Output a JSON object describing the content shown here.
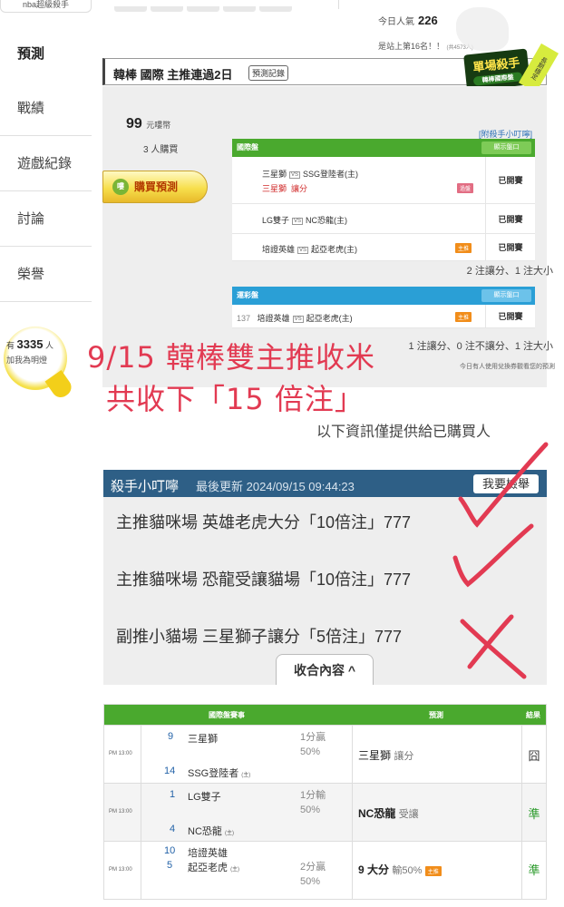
{
  "sidebar": {
    "top_label": "nba超級殺手",
    "items": [
      {
        "label": "預測"
      },
      {
        "label": "戰績"
      },
      {
        "label": "遊戲紀錄"
      },
      {
        "label": "討論"
      },
      {
        "label": "榮譽"
      }
    ],
    "fans": {
      "prefix": "有",
      "count": "3335",
      "suffix": "人",
      "sub": "加我為明燈"
    }
  },
  "header": {
    "popular_label": "今日人氣",
    "popular_value": "226",
    "rank_text": "是站上第16名！！",
    "rank_small": "(共4573人)"
  },
  "title_bar": {
    "title": "韓棒 國際 主推連過2日",
    "record_button": "預測記錄",
    "badge_main": "單場殺手",
    "badge_sub": "韓棒國際盤",
    "badge_ribbon": "長期穩定"
  },
  "purchase": {
    "price": "99",
    "price_unit": "元嘍幣",
    "buyers": "3 人購買",
    "buy_button": "購買預測",
    "tip_link": "[附殺手小叮嚀]"
  },
  "intl_table": {
    "header": "國際盤",
    "show_button": "顯示盤口",
    "rows": [
      {
        "line1": "三星獅",
        "line1b": "SSG登陸者(主)",
        "pick": "三星獅",
        "pick_type": "讓分",
        "tag": "過盤",
        "result": "已開賽"
      },
      {
        "line1": "LG雙子",
        "line1b": "NC恐龍(主)",
        "result": "已開賽"
      },
      {
        "line1": "培證英雄",
        "line1b": "起亞老虎(主)",
        "tag": "主推",
        "result": "已開賽"
      }
    ],
    "summary": "2 注讓分、1 注大小"
  },
  "sport_table": {
    "header": "運彩盤",
    "show_button": "顯示盤口",
    "rows": [
      {
        "num": "137",
        "line1": "培證英雄",
        "line1b": "起亞老虎(主)",
        "tag": "主推",
        "result": "已開賽"
      }
    ],
    "summary": "1 注讓分、0 注不讓分、1 注大小",
    "note": "今日有人使用兌換券觀看您的預測"
  },
  "handwriting": {
    "line1": "9/15 韓棒雙主推收米",
    "line2": "共收下「15 倍注」"
  },
  "notice": "以下資訊僅提供給已購買人",
  "tips": {
    "title": "殺手小叮嚀",
    "updated": "最後更新 2024/09/15 09:44:23",
    "report_button": "我要檢舉",
    "lines": [
      "主推貓咪場 英雄老虎大分「10倍注」777",
      "主推貓咪場 恐龍受讓貓場「10倍注」777",
      "副推小貓場 三星獅子讓分「5倍注」777"
    ],
    "collapse_button": "收合內容 ^"
  },
  "results": {
    "headers": {
      "game": "國際盤賽事",
      "pred": "預測",
      "result": "結果"
    },
    "rows": [
      {
        "time": "PM 13:00",
        "n1": "9",
        "t1": "三星獅",
        "n2": "14",
        "t2": "SSG登陸者",
        "home": "(主)",
        "odds1": "1分贏",
        "odds2": "50%",
        "pred": "三星獅",
        "pred_type": "讓分",
        "verdict": "囧"
      },
      {
        "time": "PM 13:00",
        "n1": "1",
        "t1": "LG雙子",
        "n2": "4",
        "t2": "NC恐龍",
        "home": "(主)",
        "odds1": "1分輸",
        "odds2": "50%",
        "pred": "NC恐龍",
        "pred_type": "受讓",
        "verdict": "準"
      },
      {
        "time": "PM 13:00",
        "n1": "10",
        "t1": "培證英雄",
        "n2": "5",
        "t2": "起亞老虎",
        "home": "(主)",
        "odds1": "2分贏",
        "odds2": "50%",
        "pred": "9 大分",
        "pred_type": "輸50%",
        "tag": "主推",
        "verdict": "準"
      }
    ]
  },
  "colors": {
    "green_header": "#4aa92e",
    "blue_header": "#2a9fd6",
    "tips_header": "#2e5f86",
    "handwriting": "#e23a52"
  }
}
